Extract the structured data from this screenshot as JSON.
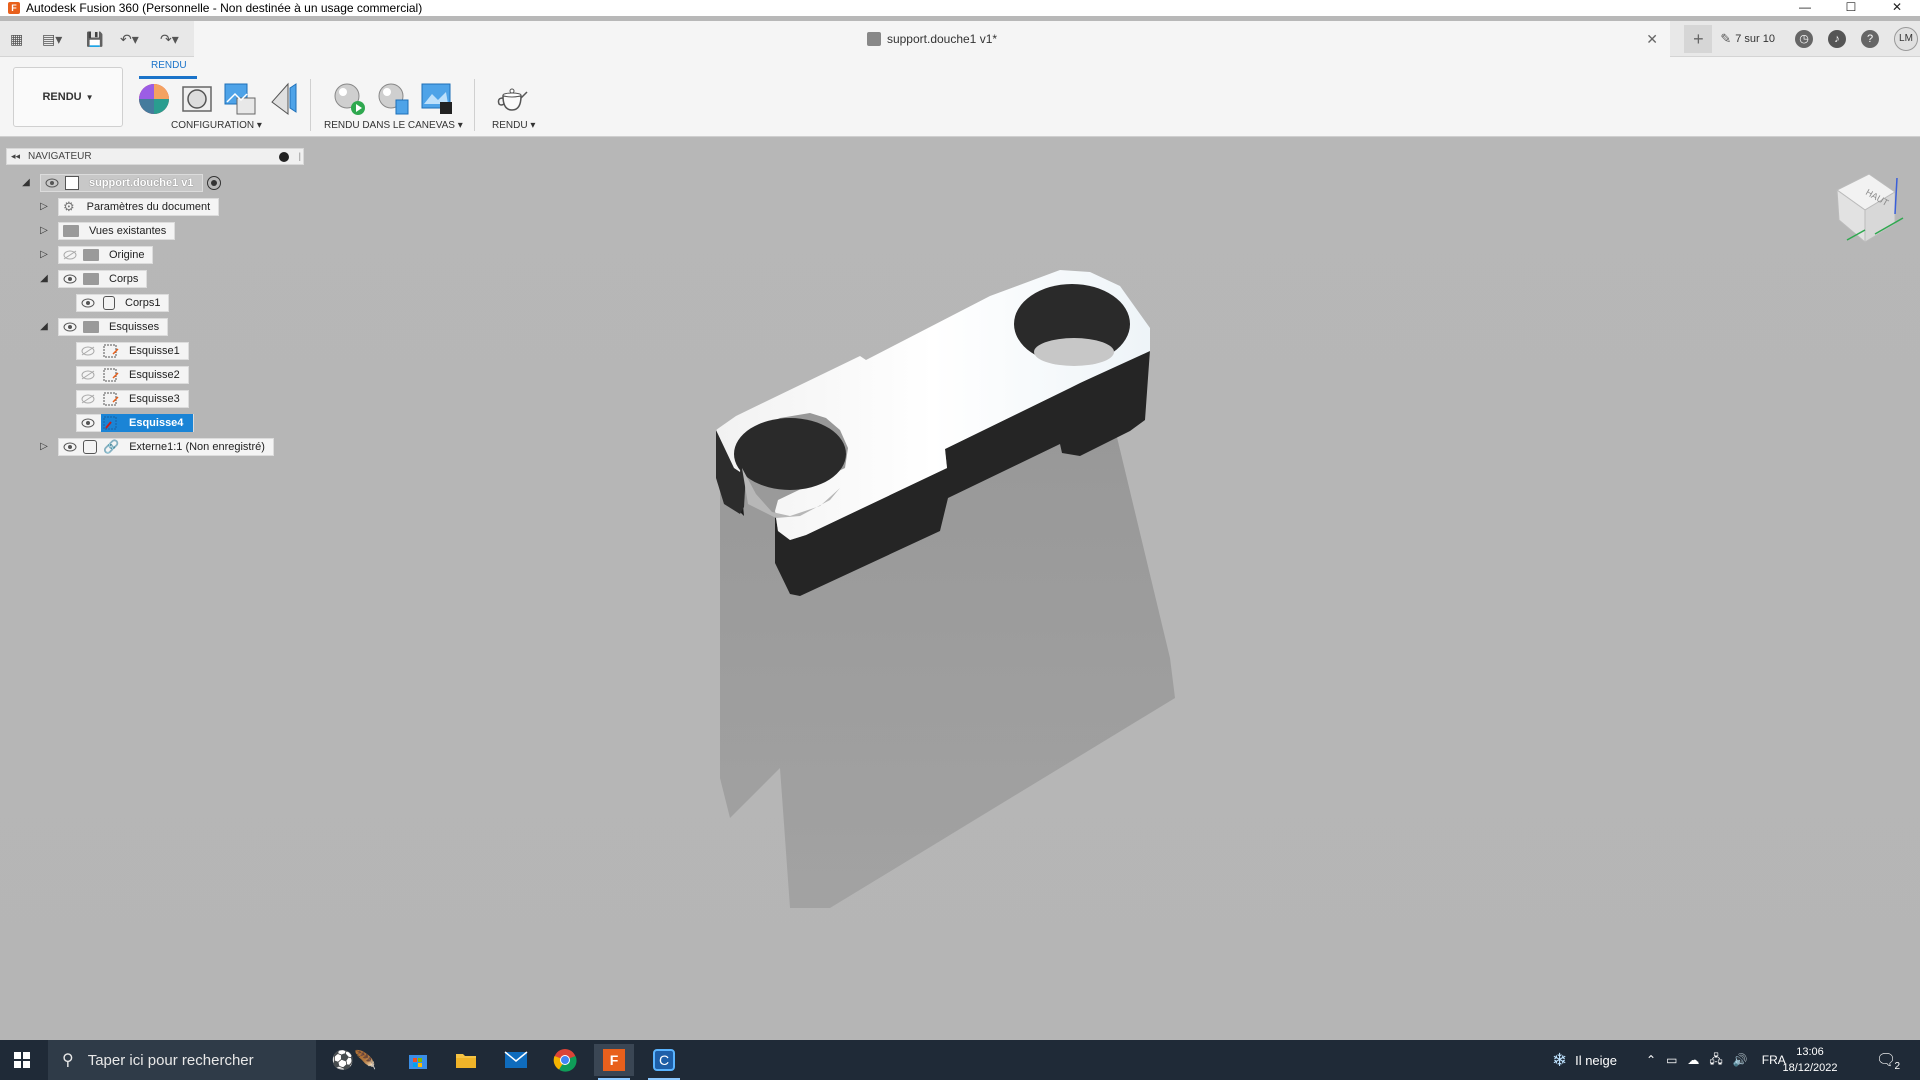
{
  "window": {
    "title": "Autodesk Fusion 360 (Personnelle - Non destinée à un usage commercial)",
    "app_icon": "F"
  },
  "qabar": {
    "doc_tab_title": "support.douche1 v1*",
    "jobs_label": "7 sur 10",
    "avatar_initials": "LM"
  },
  "ribbon": {
    "workspace": "RENDU",
    "tab": "RENDU",
    "groups": {
      "configuration": "CONFIGURATION",
      "canvas_render": "RENDU DANS LE CANEVAS",
      "render": "RENDU"
    }
  },
  "navigator": {
    "title": "NAVIGATEUR",
    "root": "support.douche1 v1",
    "items": [
      {
        "label": "Paramètres du document"
      },
      {
        "label": "Vues existantes"
      },
      {
        "label": "Origine"
      },
      {
        "label": "Corps"
      },
      {
        "label": "Corps1"
      },
      {
        "label": "Esquisses"
      },
      {
        "label": "Esquisse1"
      },
      {
        "label": "Esquisse2"
      },
      {
        "label": "Esquisse3"
      },
      {
        "label": "Esquisse4"
      },
      {
        "label": "Externe1:1 (Non enregistré)"
      }
    ]
  },
  "viewcube": {
    "face": "HAUT"
  },
  "taskbar": {
    "search_placeholder": "Taper ici pour rechercher",
    "weather": "Il neige",
    "language": "FRA",
    "time": "13:06",
    "date": "18/12/2022",
    "notifications": "2"
  },
  "colors": {
    "accent": "#1a84d6",
    "viewport": "#b7b7b7",
    "taskbar": "#1f2a37",
    "fusion_orange": "#e8601c"
  }
}
